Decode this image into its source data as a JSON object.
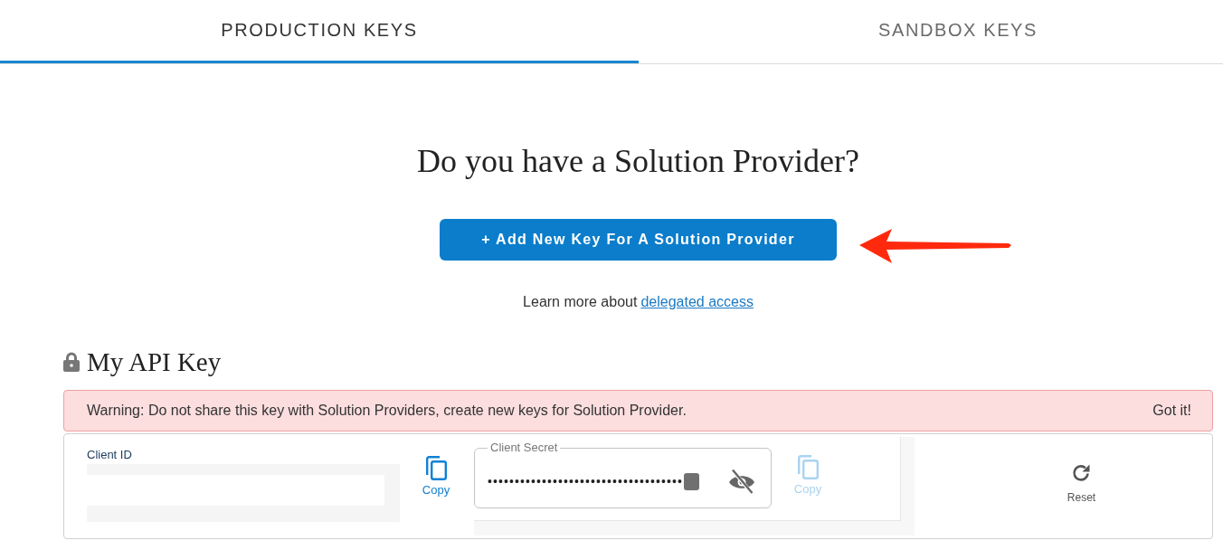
{
  "tabs": [
    {
      "label": "PRODUCTION KEYS",
      "selected": true
    },
    {
      "label": "SANDBOX KEYS",
      "selected": false
    }
  ],
  "solution_provider": {
    "heading": "Do you have a Solution Provider?",
    "add_button": "+ Add New Key For A Solution Provider",
    "annotations": [
      {
        "kind": "arrow"
      }
    ],
    "learn_more": {
      "text": "Learn more about",
      "link": "delegated access"
    }
  },
  "api_key": {
    "title": "My API Key",
    "warning": {
      "text": "Warning: Do not share this key with Solution Providers, create new keys for Solution Provider.",
      "dismiss": "Got it!"
    },
    "client_id": {
      "label": "Client ID",
      "copy": {
        "label": "Copy",
        "disabled": false
      }
    },
    "client_secret": {
      "label": "Client Secret",
      "value": "••••••••••••••••••••••••••••••••••••",
      "masked": true,
      "copy": {
        "label": "Copy",
        "disabled": true
      }
    },
    "reset": "Reset"
  }
}
